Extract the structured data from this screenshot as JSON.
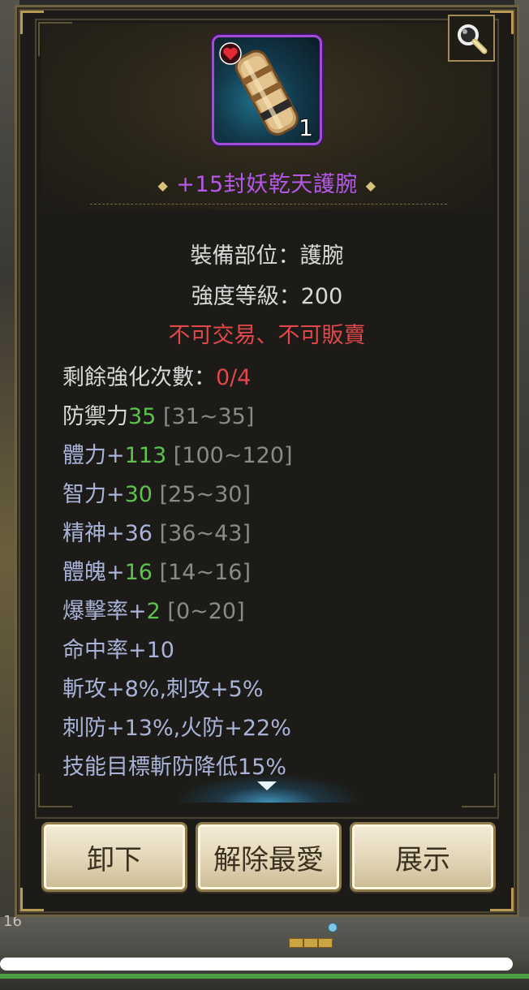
{
  "item": {
    "name": "+15封妖乾天護腕",
    "count": "1",
    "rarity_color": "#b458e6"
  },
  "info": {
    "slot": "裝備部位：護腕",
    "level": "強度等級：200",
    "restriction": "不可交易、不可販賣"
  },
  "enhance": {
    "label": "剩餘強化次數：",
    "value": "0/4"
  },
  "stats": [
    {
      "name": "防禦力",
      "value": "35",
      "range": "[31~35]"
    },
    {
      "name": "體力+",
      "value": "113",
      "range": "[100~120]"
    },
    {
      "name": "智力+",
      "value": "30",
      "range": "[25~30]"
    },
    {
      "name": "精神+36",
      "value": "",
      "range": "[36~43]"
    },
    {
      "name": "體魄+",
      "value": "16",
      "range": "[14~16]"
    },
    {
      "name": "爆擊率+",
      "value": "2",
      "range": "[0~20]"
    }
  ],
  "extra_stats": [
    "命中率+10",
    "斬攻+8%,刺攻+5%",
    "刺防+13%,火防+22%",
    "技能目標斬防降低15%"
  ],
  "buttons": {
    "unequip": "卸下",
    "unfavorite": "解除最愛",
    "display": "展示"
  },
  "background": {
    "level_number": "16"
  },
  "icons": {
    "magnifier": "magnifier-icon",
    "favorite": "heart-icon",
    "scroll": "scroll-down-icon"
  }
}
